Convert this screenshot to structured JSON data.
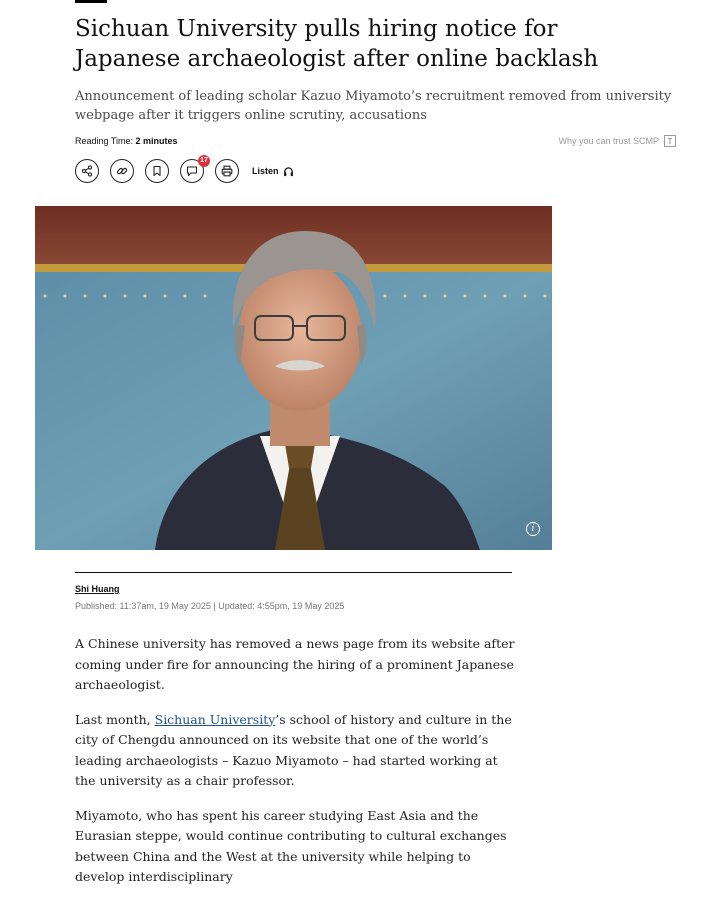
{
  "article": {
    "headline": "Sichuan University pulls hiring notice for Japanese archaeologist after online backlash",
    "subheadline": "Announcement of leading scholar Kazuo Miyamoto’s recruitment removed from university webpage after it triggers online scrutiny, accusations",
    "reading_time_label": "Reading Time: ",
    "reading_time_value": "2 minutes",
    "trust_label": "Why you can trust SCMP",
    "trust_icon": "T",
    "comment_count": "17",
    "listen_label": "Listen",
    "author": "Shi Huang",
    "published": "Published: 11:37am, 19 May 2025 | Updated: 4:55pm, 19 May 2025",
    "paragraphs": {
      "p1": "A Chinese university has removed a news page from its website after coming under fire for announcing the hiring of a prominent Japanese archaeologist.",
      "p2_before": "Last month, ",
      "p2_link": "Sichuan University",
      "p2_after": "’s school of history and culture in the city of Chengdu announced on its website that one of the world’s leading archaeologists – Kazuo Miyamoto – had started working at the university as a chair professor.",
      "p3": "Miyamoto, who has spent his career studying East Asia and the Eurasian steppe, would continue contributing to cultural exchanges between China and the West at the university while helping to develop interdisciplinary"
    }
  },
  "icons": {
    "share": "share-icon",
    "link": "link-icon",
    "bookmark": "bookmark-icon",
    "comment": "comment-icon",
    "print": "print-icon",
    "headphones": "headphones-icon",
    "info": "info-icon"
  },
  "colors": {
    "link": "#1e4f91",
    "badge": "#e0323c"
  }
}
